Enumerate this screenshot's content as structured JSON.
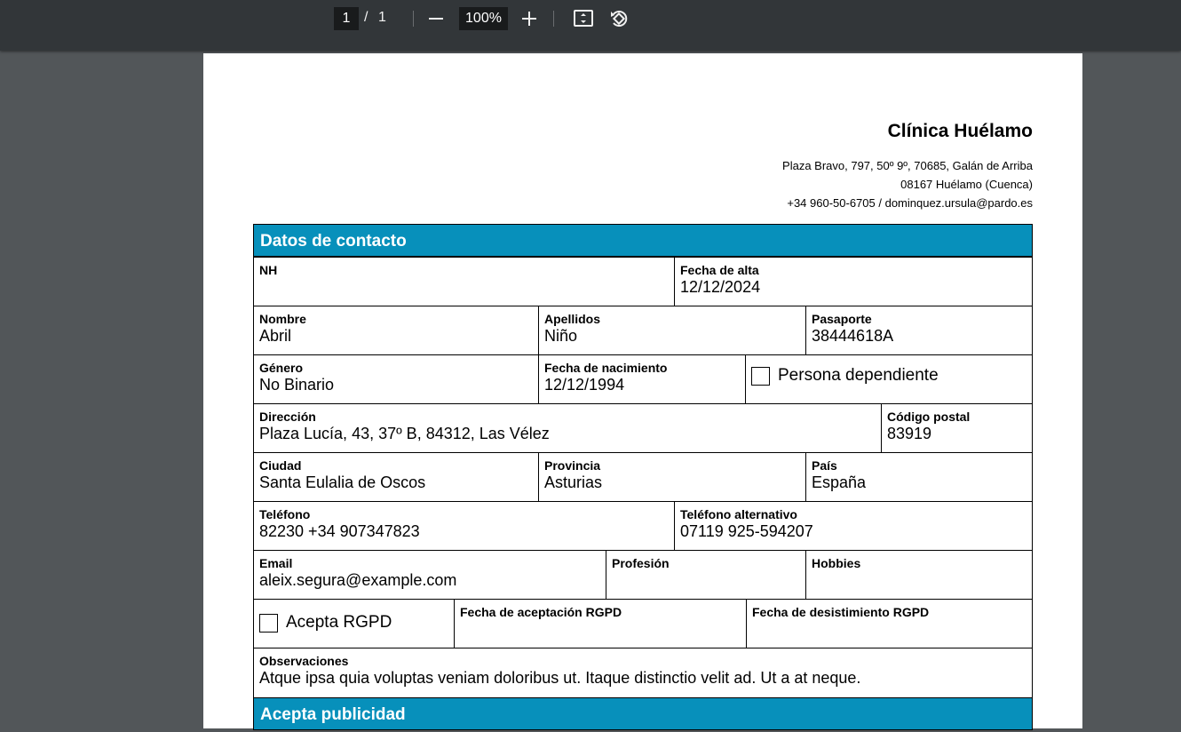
{
  "viewer": {
    "current_page": "1",
    "separator": "/",
    "total_pages": "1",
    "zoom": "100%",
    "icons": [
      "zoom-out-icon",
      "zoom-in-icon",
      "fit-page-icon",
      "rotate-icon"
    ]
  },
  "clinic": {
    "name": "Clínica Huélamo",
    "address_line1": "Plaza Bravo, 797, 50º 9º, 70685, Galán de Arriba",
    "address_line2": "08167 Huélamo (Cuenca)",
    "contact_line": "+34 960-50-6705 / dominquez.ursula@pardo.es"
  },
  "sections": {
    "contact_title": "Datos de contacto",
    "publicity_title": "Acepta publicidad"
  },
  "fields": {
    "nh": {
      "label": "NH",
      "value": ""
    },
    "fecha_alta": {
      "label": "Fecha de alta",
      "value": "12/12/2024"
    },
    "nombre": {
      "label": "Nombre",
      "value": "Abril"
    },
    "apellidos": {
      "label": "Apellidos",
      "value": "Niño"
    },
    "pasaporte": {
      "label": "Pasaporte",
      "value": "38444618A"
    },
    "genero": {
      "label": "Género",
      "value": "No Binario"
    },
    "fecha_nacimiento": {
      "label": "Fecha de nacimiento",
      "value": "12/12/1994"
    },
    "persona_dependiente": {
      "label": "Persona dependiente",
      "checked": false
    },
    "direccion": {
      "label": "Dirección",
      "value": "Plaza Lucía, 43, 37º B, 84312, Las Vélez"
    },
    "codigo_postal": {
      "label": "Código postal",
      "value": "83919"
    },
    "ciudad": {
      "label": "Ciudad",
      "value": "Santa Eulalia de Oscos"
    },
    "provincia": {
      "label": "Provincia",
      "value": "Asturias"
    },
    "pais": {
      "label": "País",
      "value": "España"
    },
    "telefono": {
      "label": "Teléfono",
      "value": "82230 +34 907347823"
    },
    "telefono_alt": {
      "label": "Teléfono alternativo",
      "value": "07119 925-594207"
    },
    "email": {
      "label": "Email",
      "value": "aleix.segura@example.com"
    },
    "profesion": {
      "label": "Profesión",
      "value": ""
    },
    "hobbies": {
      "label": "Hobbies",
      "value": ""
    },
    "acepta_rgpd": {
      "label": "Acepta RGPD",
      "checked": false
    },
    "fecha_aceptacion_rgpd": {
      "label": "Fecha de aceptación RGPD",
      "value": ""
    },
    "fecha_desistimiento_rgpd": {
      "label": "Fecha de desistimiento RGPD",
      "value": ""
    },
    "observaciones": {
      "label": "Observaciones",
      "value": "Atque ipsa quia voluptas veniam doloribus ut. Itaque distinctio velit ad. Ut a at neque."
    }
  },
  "colors": {
    "toolbar_bg": "#323639",
    "viewer_bg": "#525659",
    "section_header_bg": "#0790bb"
  }
}
